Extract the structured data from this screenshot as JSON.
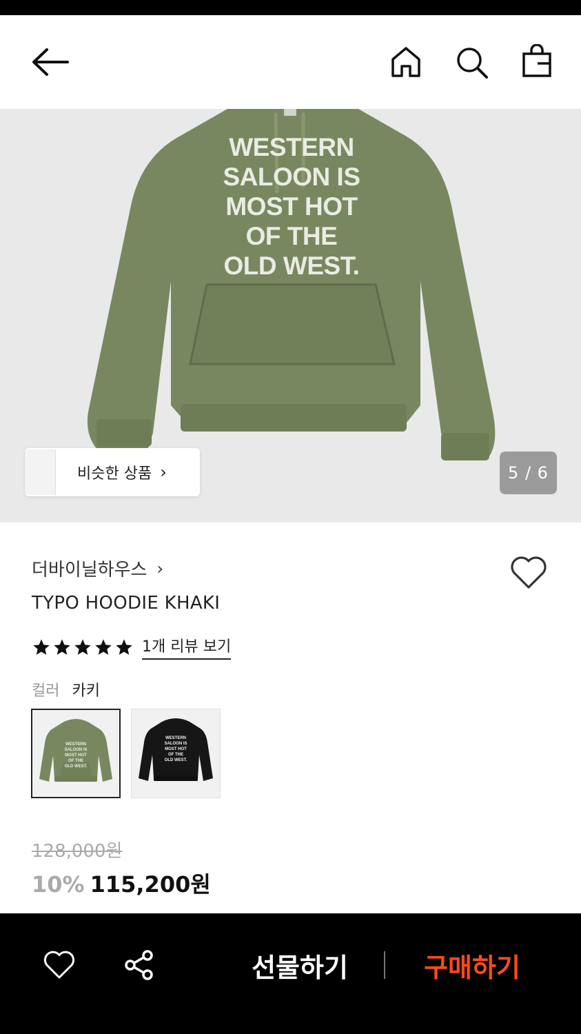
{
  "header": {
    "back_icon": "arrow-left-icon",
    "home_icon": "home-icon",
    "search_icon": "search-icon",
    "bag_icon": "shopping-bag-icon"
  },
  "gallery": {
    "print_lines": [
      "WESTERN",
      "SALOON IS",
      "MOST HOT",
      "OF THE",
      "OLD WEST."
    ],
    "similar_label": "비슷한 상품",
    "similar_chevron": "›",
    "counter": "5 / 6"
  },
  "product": {
    "brand": "더바이닐하우스",
    "brand_chevron": "›",
    "title": "TYPO HOODIE KHAKI",
    "rating_stars": 5,
    "review_link": "1개 리뷰 보기",
    "color_label": "컬러",
    "color_value": "카키",
    "swatches": [
      {
        "name": "khaki",
        "selected": true,
        "print": [
          "WESTERN",
          "SALOON IS",
          "MOST HOT",
          "OF THE",
          "OLD WEST."
        ]
      },
      {
        "name": "black",
        "selected": false,
        "print": [
          "WESTERN",
          "SALOON IS",
          "MOST HOT",
          "OF THE",
          "OLD WEST."
        ]
      }
    ],
    "original_price": "128,000원",
    "discount": "10%",
    "price": "115,200원"
  },
  "bottom_bar": {
    "like_icon": "heart-icon",
    "share_icon": "share-icon",
    "gift_label": "선물하기",
    "buy_label": "구매하기"
  },
  "colors": {
    "hoodie_khaki": "#78875f",
    "accent_orange": "#ff4a1c",
    "counter_bg": "#9b9b9b"
  }
}
